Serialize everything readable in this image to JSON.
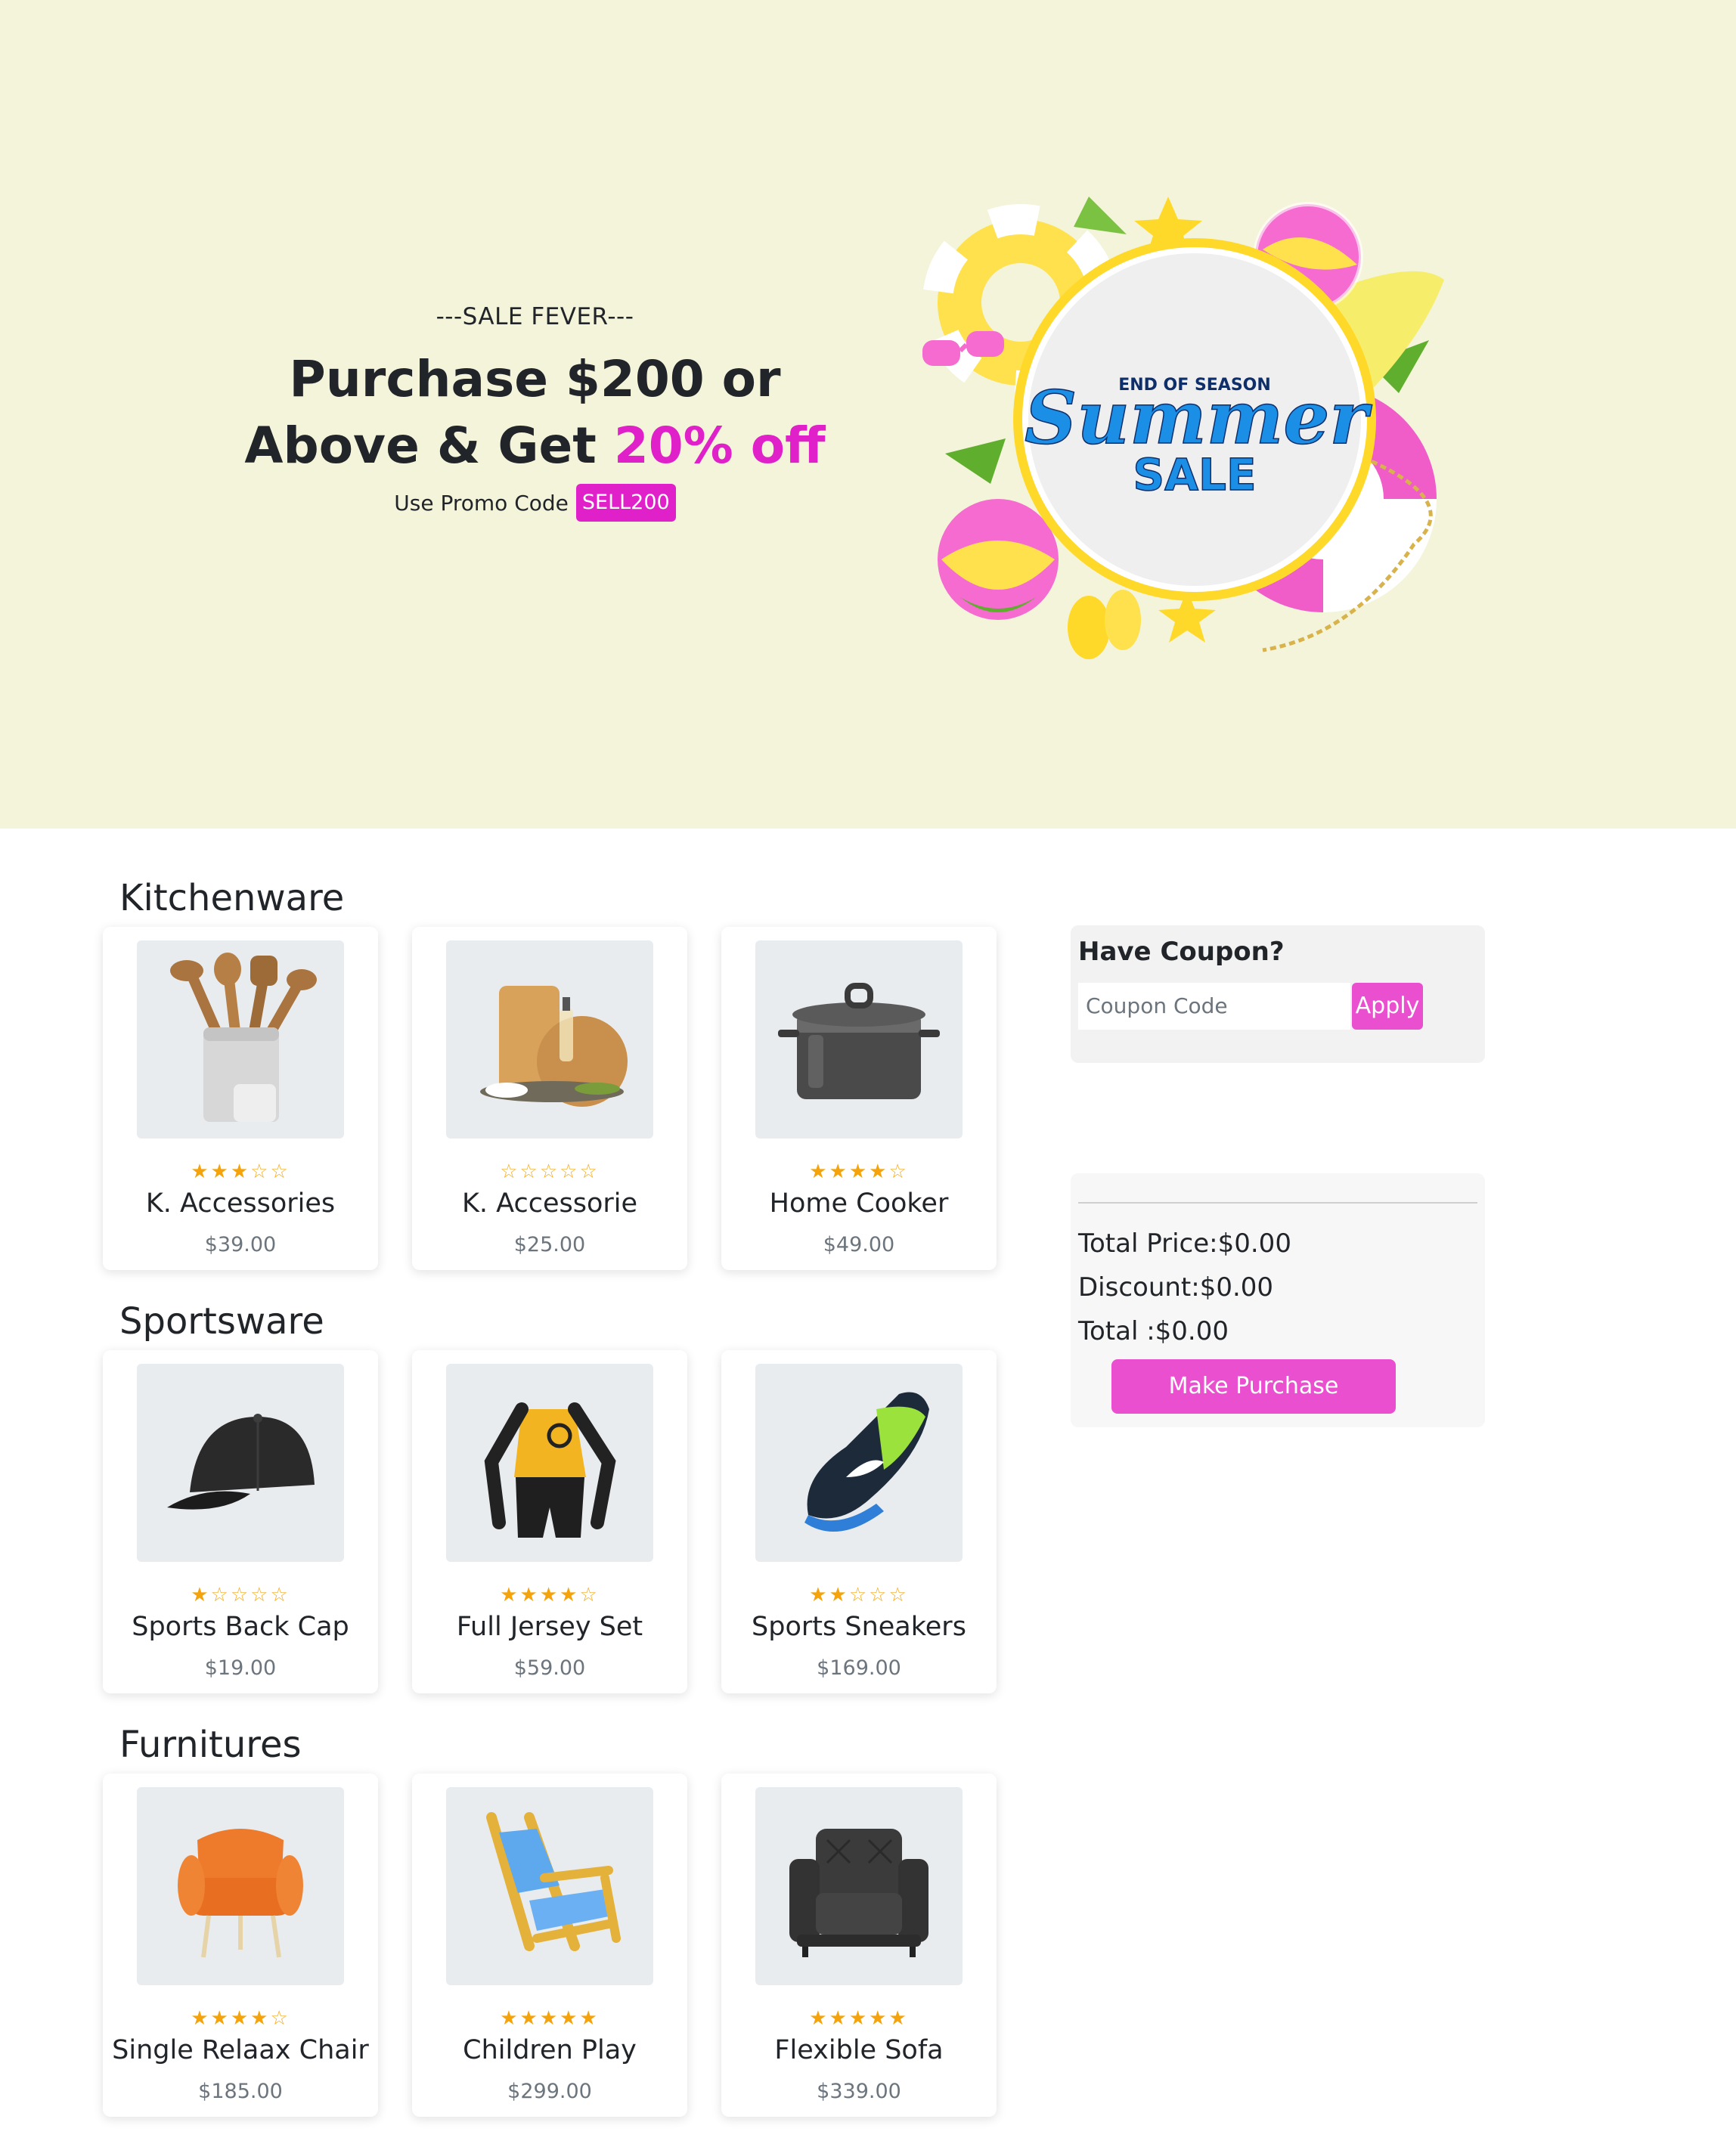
{
  "hero": {
    "kicker": "---SALE FEVER---",
    "title_line1": "Purchase $200 or",
    "title_line2_prefix": "Above & Get ",
    "title_line2_accent": "20% off",
    "promo_label": "Use Promo Code",
    "promo_code": "SELL200",
    "banner": {
      "top_text": "END OF SEASON",
      "script_text": "Summer",
      "bottom_text": "SALE"
    }
  },
  "categories": [
    {
      "title": "Kitchenware",
      "products": [
        {
          "name": "K. Accessories",
          "price": "$39.00",
          "rating": 3,
          "image": "kitchen-utensils"
        },
        {
          "name": "K. Accessorie",
          "price": "$25.00",
          "rating": 0,
          "image": "cutting-boards"
        },
        {
          "name": "Home Cooker",
          "price": "$49.00",
          "rating": 4,
          "image": "cooking-pot"
        }
      ]
    },
    {
      "title": "Sportsware",
      "products": [
        {
          "name": "Sports Back Cap",
          "price": "$19.00",
          "rating": 1,
          "image": "baseball-cap"
        },
        {
          "name": "Full Jersey Set",
          "price": "$59.00",
          "rating": 4,
          "image": "cycling-jersey"
        },
        {
          "name": "Sports Sneakers",
          "price": "$169.00",
          "rating": 2,
          "image": "running-sneaker"
        }
      ]
    },
    {
      "title": "Furnitures",
      "products": [
        {
          "name": "Single Relaax Chair",
          "price": "$185.00",
          "rating": 4,
          "image": "armchair"
        },
        {
          "name": "Children Play",
          "price": "$299.00",
          "rating": 5,
          "image": "folding-chair"
        },
        {
          "name": "Flexible Sofa",
          "price": "$339.00",
          "rating": 5,
          "image": "sofa-chair"
        }
      ]
    }
  ],
  "coupon": {
    "title": "Have Coupon?",
    "placeholder": "Coupon Code",
    "apply_label": "Apply"
  },
  "totals": {
    "total_price": "Total Price:$0.00",
    "discount": "Discount:$0.00",
    "total": "Total :$0.00",
    "purchase_label": "Make Purchase"
  },
  "colors": {
    "hero_bg": "#f4f4da",
    "accent": "#e020c8",
    "button": "#ea4fd0",
    "star": "#f5a30a"
  }
}
